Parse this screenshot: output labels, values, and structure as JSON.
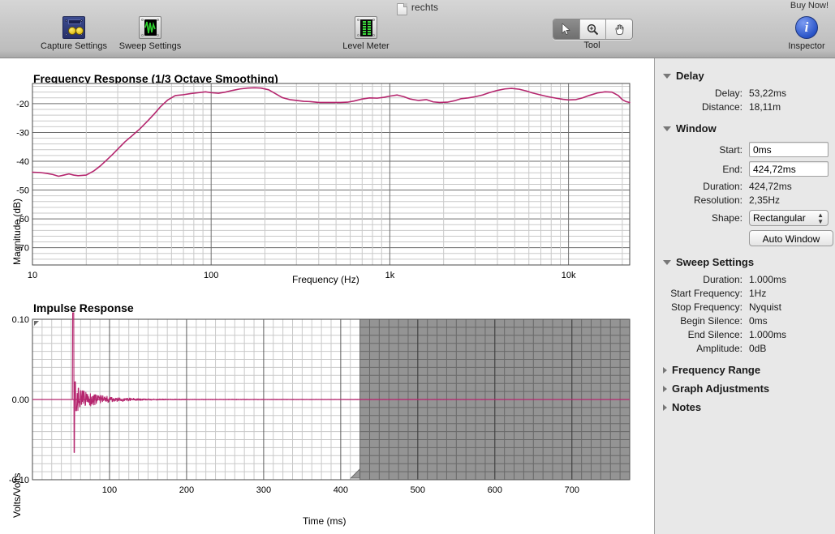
{
  "window": {
    "document_title": "rechts",
    "buy_now": "Buy Now!"
  },
  "toolbar": {
    "items": [
      {
        "label": "Capture Settings",
        "icon": "capture-settings-icon"
      },
      {
        "label": "Sweep Settings",
        "icon": "sweep-settings-icon"
      },
      {
        "label": "Level Meter",
        "icon": "level-meter-icon"
      }
    ],
    "tool_group_label": "Tool",
    "tools": [
      {
        "name": "arrow-tool",
        "glyph": "arrow",
        "selected": true
      },
      {
        "name": "zoom-tool",
        "glyph": "magnifier",
        "selected": false
      },
      {
        "name": "hand-tool",
        "glyph": "hand",
        "selected": false
      }
    ],
    "inspector_label": "Inspector",
    "inspector_glyph": "i"
  },
  "inspector": {
    "sections": [
      {
        "id": "delay",
        "title": "Delay",
        "expanded": true,
        "rows": [
          {
            "label": "Delay:",
            "value": "53,22ms"
          },
          {
            "label": "Distance:",
            "value": "18,11m"
          }
        ]
      },
      {
        "id": "window",
        "title": "Window",
        "expanded": true,
        "rows": [
          {
            "label": "Start:",
            "value": "0ms",
            "type": "field"
          },
          {
            "label": "End:",
            "value": "424,72ms",
            "type": "field"
          },
          {
            "label": "Duration:",
            "value": "424,72ms",
            "type": "text"
          },
          {
            "label": "Resolution:",
            "value": "2,35Hz",
            "type": "text"
          },
          {
            "label": "Shape:",
            "value": "Rectangular",
            "type": "popup"
          }
        ],
        "button": "Auto Window"
      },
      {
        "id": "sweep-settings",
        "title": "Sweep Settings",
        "expanded": true,
        "rows": [
          {
            "label": "Duration:",
            "value": "1.000ms"
          },
          {
            "label": "Start Frequency:",
            "value": "1Hz"
          },
          {
            "label": "Stop Frequency:",
            "value": "Nyquist"
          },
          {
            "label": "Begin Silence:",
            "value": "0ms"
          },
          {
            "label": "End Silence:",
            "value": "1.000ms"
          },
          {
            "label": "Amplitude:",
            "value": "0dB"
          }
        ]
      },
      {
        "id": "frequency-range",
        "title": "Frequency Range",
        "expanded": false,
        "rows": []
      },
      {
        "id": "graph-adjustments",
        "title": "Graph Adjustments",
        "expanded": false,
        "rows": []
      },
      {
        "id": "notes",
        "title": "Notes",
        "expanded": false,
        "rows": []
      }
    ]
  },
  "chart_data": [
    {
      "type": "line",
      "id": "frequency-response",
      "title": "Frequency Response (1/3 Octave Smoothing)",
      "xlabel": "Frequency (Hz)",
      "ylabel": "Magnitude (dB)",
      "xscale": "log",
      "xlim": [
        10,
        22000
      ],
      "ylim": [
        -76,
        -13
      ],
      "xticks": [
        10,
        100,
        1000,
        10000
      ],
      "xticklabels": [
        "10",
        "100",
        "1k",
        "10k"
      ],
      "yticks": [
        -20,
        -30,
        -40,
        -50,
        -60,
        -70
      ],
      "yticklabels": [
        "-20",
        "-30",
        "-40",
        "-50",
        "-60",
        "-70"
      ],
      "grid": true,
      "minor_grid_db": 2,
      "legend": null,
      "color": "#b5266e",
      "series": [
        {
          "name": "magnitude",
          "x": [
            10,
            11,
            12,
            13,
            14,
            15,
            16,
            17,
            18,
            19,
            20,
            22,
            24,
            26,
            28,
            30,
            33,
            36,
            40,
            44,
            48,
            52,
            57,
            63,
            70,
            77,
            85,
            93,
            100,
            110,
            120,
            132,
            145,
            160,
            175,
            190,
            210,
            230,
            250,
            275,
            300,
            330,
            360,
            400,
            440,
            480,
            530,
            580,
            630,
            700,
            770,
            850,
            930,
            1000,
            1100,
            1200,
            1300,
            1450,
            1600,
            1750,
            1900,
            2100,
            2300,
            2500,
            2750,
            3000,
            3300,
            3600,
            4000,
            4400,
            4800,
            5300,
            5800,
            6300,
            7000,
            7700,
            8500,
            9300,
            10000,
            11000,
            12000,
            13000,
            14500,
            16000,
            17500,
            19000,
            20000,
            21000,
            22000
          ],
          "y": [
            -43.8,
            -43.9,
            -44.2,
            -44.6,
            -45.2,
            -44.8,
            -44.4,
            -44.8,
            -45.0,
            -44.9,
            -44.8,
            -43.4,
            -41.6,
            -39.6,
            -37.7,
            -35.8,
            -33.2,
            -31.2,
            -28.7,
            -26.1,
            -23.6,
            -21.1,
            -18.8,
            -17.2,
            -16.9,
            -16.5,
            -16.2,
            -15.9,
            -16.2,
            -16.4,
            -16.0,
            -15.4,
            -14.9,
            -14.6,
            -14.5,
            -14.6,
            -15.2,
            -16.6,
            -17.9,
            -18.6,
            -18.9,
            -19.2,
            -19.3,
            -19.6,
            -19.6,
            -19.6,
            -19.6,
            -19.5,
            -19.1,
            -18.4,
            -18.0,
            -18.1,
            -17.8,
            -17.4,
            -17.0,
            -17.6,
            -18.4,
            -18.9,
            -18.6,
            -19.4,
            -19.6,
            -19.5,
            -19.0,
            -18.3,
            -18.0,
            -17.6,
            -17.0,
            -16.2,
            -15.4,
            -14.9,
            -14.7,
            -15.0,
            -15.6,
            -16.3,
            -17.0,
            -17.6,
            -18.1,
            -18.5,
            -18.7,
            -18.6,
            -18.0,
            -17.2,
            -16.3,
            -15.9,
            -16.0,
            -17.2,
            -18.6,
            -19.3,
            -19.6,
            -19.8
          ]
        }
      ]
    },
    {
      "type": "line",
      "id": "impulse-response",
      "title": "Impulse Response",
      "xlabel": "Time (ms)",
      "ylabel": "Volts/Volts",
      "xscale": "linear",
      "xlim": [
        0,
        775
      ],
      "ylim": [
        -0.1,
        0.1
      ],
      "xticks": [
        100,
        200,
        300,
        400,
        500,
        600,
        700
      ],
      "xticklabels": [
        "100",
        "200",
        "300",
        "400",
        "500",
        "600",
        "700"
      ],
      "yticks": [
        0.1,
        0.0,
        -0.1
      ],
      "yticklabels": [
        "0.10",
        "0.00",
        "-0.10"
      ],
      "grid": true,
      "color": "#b5266e",
      "window_start_ms": 0,
      "window_end_ms": 424.72,
      "excluded_region_color": "#7c7c7c",
      "peak_time_ms": 53.22,
      "peak_value": 0.1,
      "trough_value": -0.065,
      "series": [
        {
          "name": "impulse",
          "note": "flat near 0 except sharp bipolar spike at 53.22ms, then decaying noise ringing out to ~250ms"
        }
      ]
    }
  ]
}
